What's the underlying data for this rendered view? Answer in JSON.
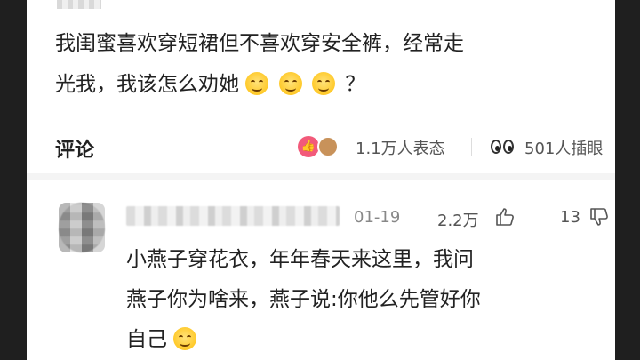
{
  "post": {
    "text_line1": "我闺蜜喜欢穿短裙但不喜欢穿安全裤，经常走",
    "text_line2": "光我，我该怎么劝她",
    "text_tail": "？",
    "emoji_name": "smile-emoji"
  },
  "stats": {
    "comments_label": "评论",
    "reactions_text": "1.1万人表态",
    "peek_text": "501人插眼"
  },
  "comment": {
    "date": "01-19",
    "likes": "2.2万",
    "dislikes": "13",
    "text_line1": "小燕子穿花衣，年年春天来这里，我问",
    "text_line2": "燕子你为啥来，燕子说:你他么先管好你",
    "text_line3": "自己"
  },
  "colors": {
    "background": "#ffffff",
    "accent_like": "#f25a7a",
    "text_primary": "#222222",
    "text_secondary": "#555555"
  }
}
